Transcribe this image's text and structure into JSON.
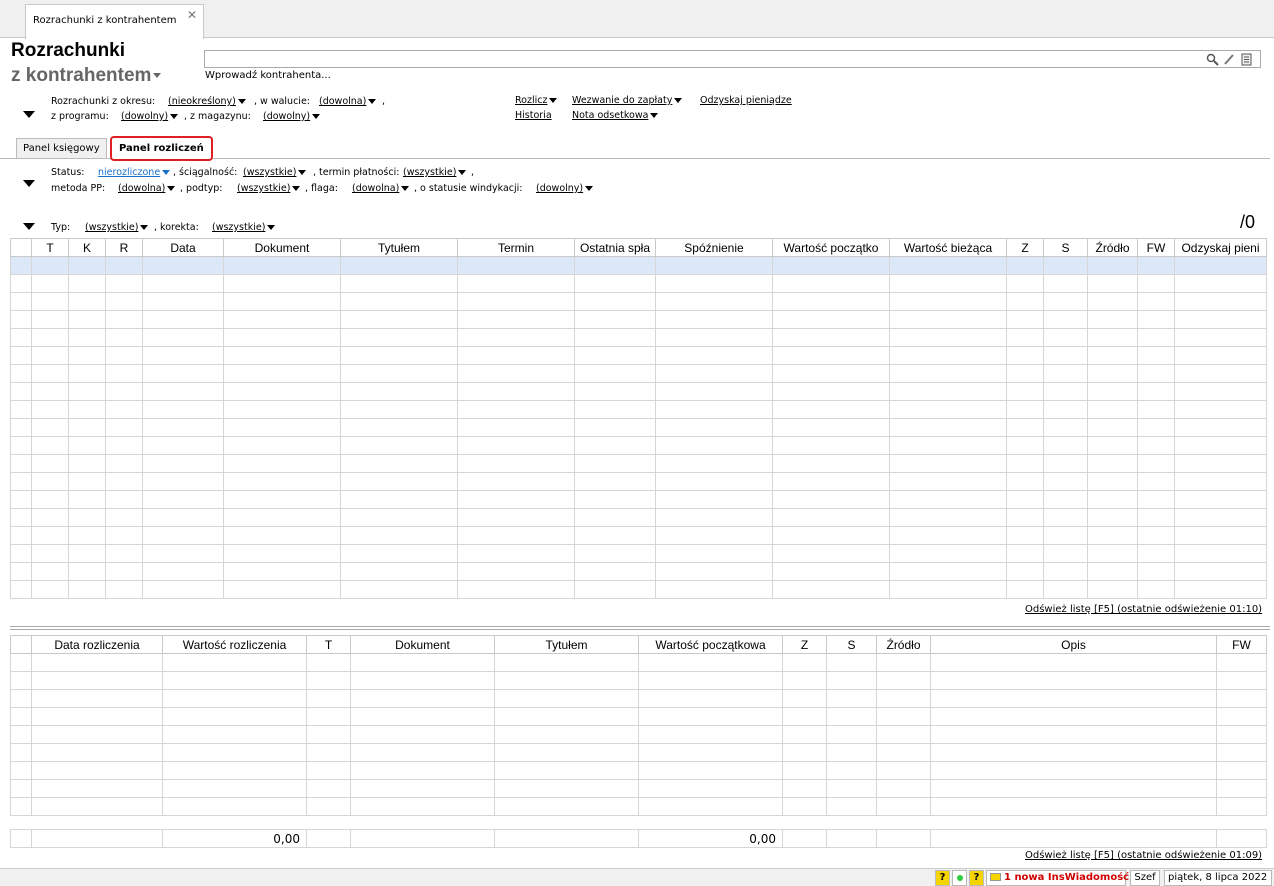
{
  "window": {
    "tab_label": "Rozrachunki z kontrahentem",
    "close_glyph": "✕"
  },
  "header": {
    "title_line1": "Rozrachunki",
    "title_line2": "z kontrahentem",
    "search_placeholder": "",
    "search_hint": "Wprowadź kontrahenta..."
  },
  "filters": {
    "period_label": "Rozrachunki z okresu:",
    "period_value": "(nieokreślony)",
    "currency_label": ", w walucie:",
    "currency_value": "(dowolna)",
    "currency_trail": ",",
    "program_label": "z programu:",
    "program_value": "(dowolny)",
    "warehouse_label": ", z magazynu:",
    "warehouse_value": "(dowolny)"
  },
  "actions": {
    "rozlicz": "Rozlicz",
    "wezwanie": "Wezwanie do zapłaty",
    "odzyskaj": "Odzyskaj pieniądze",
    "historia": "Historia",
    "nota": "Nota odsetkowa"
  },
  "panel_tabs": {
    "ksiegowy": "Panel księgowy",
    "rozliczen": "Panel rozliczeń"
  },
  "status_filters": {
    "status_label": "Status:",
    "status_value": "nierozliczone",
    "sciagalnosc_label": ", ściągalność:",
    "sciagalnosc_value": "(wszystkie)",
    "termin_label": ", termin płatności:",
    "termin_value": "(wszystkie)",
    "termin_trail": ",",
    "metoda_label": "metoda PP:",
    "metoda_value": "(dowolna)",
    "podtyp_label": ", podtyp:",
    "podtyp_value": "(wszystkie)",
    "flaga_label": ", flaga:",
    "flaga_value": "(dowolna)",
    "windykacja_label": ", o statusie windykacji:",
    "windykacja_value": "(dowolny)"
  },
  "type_filters": {
    "typ_label": "Typ:",
    "typ_value": "(wszystkie)",
    "korekta_label": ", korekta:",
    "korekta_value": "(wszystkie)",
    "counter": "/0"
  },
  "top_table": {
    "columns": [
      "",
      "T",
      "K",
      "R",
      "Data",
      "Dokument",
      "Tytułem",
      "Termin",
      "Ostatnia spła",
      "Spóźnienie",
      "Wartość początko",
      "Wartość bieżąca",
      "Z",
      "S",
      "Źródło",
      "FW",
      "Odzyskaj pieni"
    ],
    "refresh": "Odśwież listę [F5] (ostatnie odświeżenie 01:10)"
  },
  "bottom_table": {
    "columns": [
      "",
      "Data rozliczenia",
      "Wartość rozliczenia",
      "T",
      "Dokument",
      "Tytułem",
      "Wartość początkowa",
      "Z",
      "S",
      "Źródło",
      "Opis",
      "FW"
    ],
    "sum_rozliczenia": "0,00",
    "sum_poczatkowa": "0,00",
    "refresh": "Odśwież listę [F5] (ostatnie odświeżenie 01:09)"
  },
  "statusbar": {
    "q1": "?",
    "q2": "?",
    "message": "1 nowa InsWiadomość",
    "user": "Szef",
    "date": "piątek, 8 lipca 2022"
  },
  "colors": {
    "accent_blue": "#1a6fc8",
    "selection": "#dce8f7",
    "active_tab_border": "#e02020",
    "message_red": "#d00000"
  }
}
